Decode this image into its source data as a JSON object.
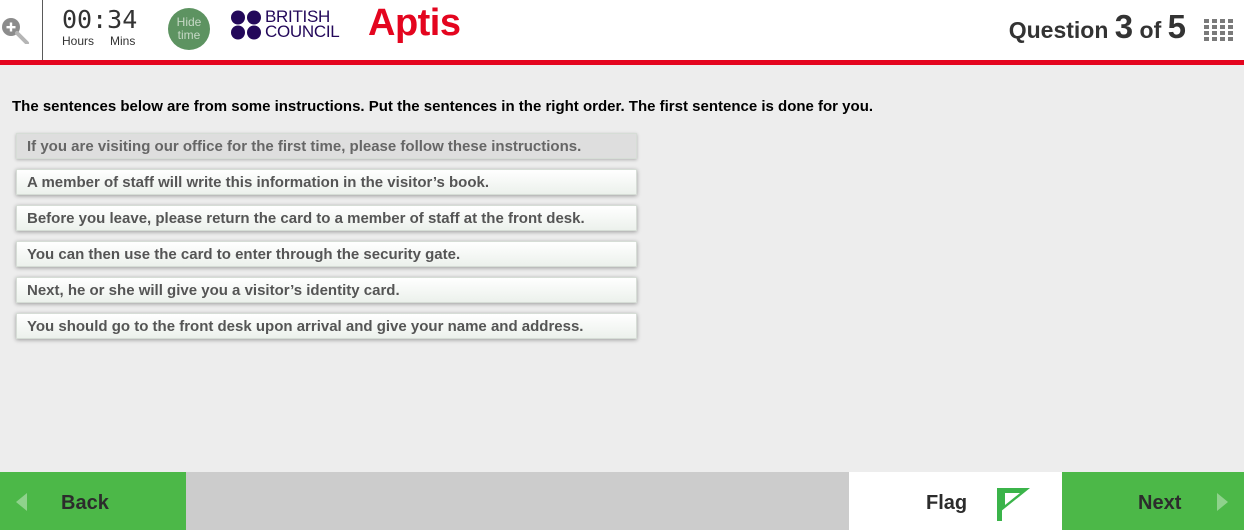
{
  "header": {
    "zoom_icon": "zoom-in-icon",
    "timer": {
      "digits": "00:34",
      "hours_label": "Hours",
      "mins_label": "Mins"
    },
    "hide_time_label": "Hide time",
    "brand": {
      "line1": "BRITISH",
      "line2": "COUNCIL",
      "product": "Aptis"
    },
    "question": {
      "word": "Question",
      "current": "3",
      "of": "of",
      "total": "5"
    },
    "grid_icon": "question-grid-icon",
    "colors": {
      "accent_red": "#e4051f",
      "brand_navy": "#23085a",
      "hide_button": "#5d9361"
    }
  },
  "main": {
    "instruction": "The sentences below are from some instructions. Put the sentences in the right order. The first sentence is done for you.",
    "sentences": [
      "If you are visiting our office for the first time, please follow these instructions.",
      "A member of staff will write this information in the visitor’s book.",
      "Before you leave, please return the card to a member of staff at the front desk.",
      "You can then use the card to enter through the security gate.",
      "Next, he or she will give you a visitor’s identity card.",
      "You should go to the front desk upon arrival and give your name and address."
    ]
  },
  "footer": {
    "back_label": "Back",
    "flag_label": "Flag",
    "next_label": "Next",
    "icons": {
      "back": "back-arrow-icon",
      "flag": "flag-icon",
      "next": "next-arrow-icon"
    },
    "colors": {
      "nav_green": "#4cb848",
      "flag_green": "#3bb44a"
    }
  }
}
